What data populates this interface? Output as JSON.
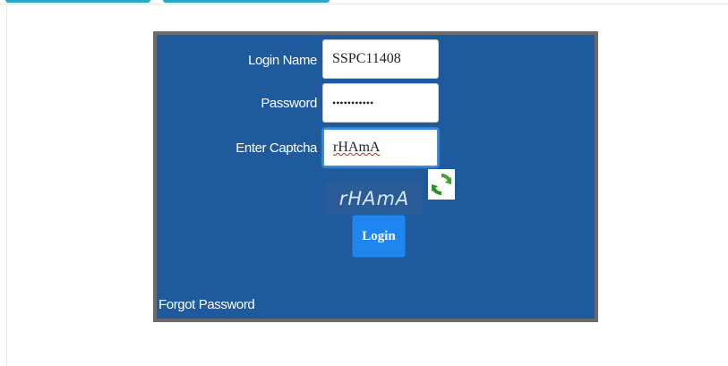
{
  "login_form": {
    "login_name_label": "Login Name",
    "login_name_value": "SSPC11408",
    "password_label": "Password",
    "password_value": "SSPC11408ab",
    "captcha_label": "Enter Captcha",
    "captcha_value": "rHAmA",
    "captcha_image_text": "rHAmA",
    "login_button_label": "Login",
    "forgot_password_label": "Forgot Password"
  },
  "icons": {
    "refresh": "refresh-icon"
  },
  "colors": {
    "panel_background": "#1f5b9c",
    "panel_border": "#6b6b6b",
    "login_button": "#1e86ee",
    "tab_accent": "#2aa7c9",
    "refresh_green": "#3da72c"
  }
}
